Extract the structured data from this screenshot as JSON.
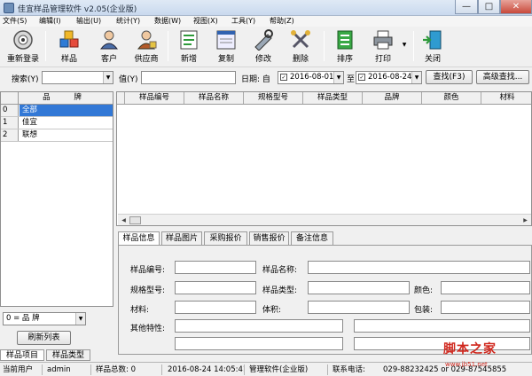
{
  "window": {
    "title": "佳宜样品管理软件 v2.05(企业版)",
    "min": "—",
    "max": "□",
    "close": "✕"
  },
  "menu": [
    "文件(S)",
    "编辑(I)",
    "输出(U)",
    "统计(Y)",
    "数据(W)",
    "视图(X)",
    "工具(Y)",
    "帮助(Z)"
  ],
  "toolbar": {
    "items": [
      {
        "label": "重新登录",
        "icon": "power-disc-icon"
      },
      {
        "label": "样品",
        "icon": "cubes-icon"
      },
      {
        "label": "客户",
        "icon": "customer-icon"
      },
      {
        "label": "供应商",
        "icon": "supplier-icon"
      },
      {
        "label": "新增",
        "icon": "new-doc-icon"
      },
      {
        "label": "复制",
        "icon": "copy-icon"
      },
      {
        "label": "修改",
        "icon": "edit-tools-icon"
      },
      {
        "label": "删除",
        "icon": "delete-icon"
      },
      {
        "label": "排序",
        "icon": "sort-icon"
      },
      {
        "label": "打印",
        "icon": "printer-icon"
      },
      {
        "label": "关闭",
        "icon": "exit-door-icon"
      }
    ]
  },
  "search": {
    "label": "搜索(Y)",
    "value_label": "值(Y)",
    "value": "",
    "date_label": "日期: 自",
    "date_from": "2016-08-01",
    "to_label": "至",
    "date_to": "2016-08-24",
    "find_btn": "查找(F3)",
    "advanced_btn": "高级查找..."
  },
  "brand_table": {
    "header_idx": "",
    "header": "品  牌",
    "rows": [
      {
        "idx": "0",
        "name": "全部",
        "selected": true
      },
      {
        "idx": "1",
        "name": "佳宜",
        "selected": false
      },
      {
        "idx": "2",
        "name": "联想",
        "selected": false
      }
    ]
  },
  "grid": {
    "columns": [
      "样品编号",
      "样品名称",
      "规格型号",
      "样品类型",
      "品牌",
      "颜色",
      "材料"
    ]
  },
  "tabs": [
    "样品信息",
    "样品图片",
    "采购报价",
    "销售报价",
    "备注信息"
  ],
  "form": {
    "code": "样品编号:",
    "name": "样品名称:",
    "spec": "规格型号:",
    "type": "样品类型:",
    "color": "颜色:",
    "material": "材料:",
    "volume": "体积:",
    "package": "包装:",
    "other": "其他特性:"
  },
  "left_bottom": {
    "combo": "0 = 品    牌",
    "refresh": "刷新列表",
    "tabs": [
      "样品项目",
      "样品类型"
    ]
  },
  "status": {
    "user_label": "当前用户",
    "user": "admin",
    "count": "样品总数: 0",
    "datetime": "2016-08-24 14:05:41",
    "edition": "管理软件(企业版)",
    "phone": "联系电话:",
    "phone_no": "029-88232425 or 029-87545855"
  },
  "watermark": {
    "main": "脚本之家",
    "url": "www.jb51.net"
  },
  "colors": {
    "selection": "#3278d6",
    "watermark": "#d0281e"
  }
}
